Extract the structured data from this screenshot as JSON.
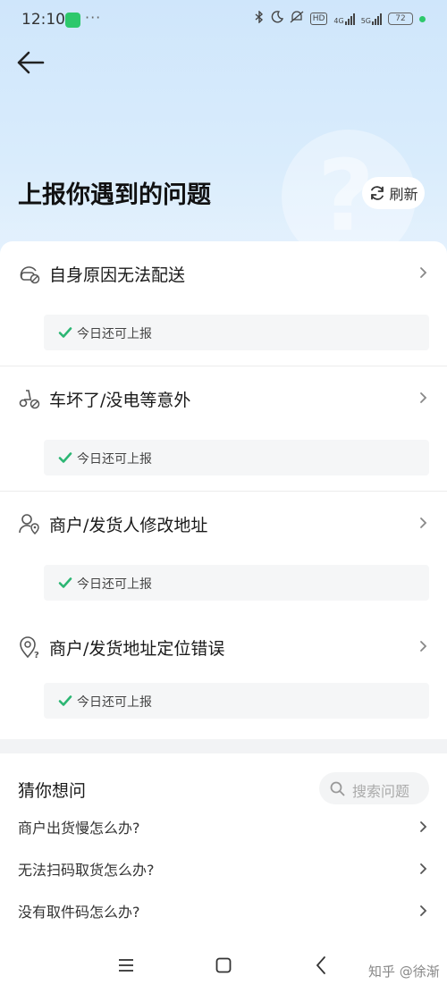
{
  "status_bar": {
    "time": "12:10",
    "dots": "···",
    "hd": "HD",
    "net4g": "4G",
    "net5g": "5G",
    "battery": "72"
  },
  "header": {
    "title": "上报你遇到的问题",
    "refresh_label": "刷新"
  },
  "issues": [
    {
      "title": "自身原因无法配送",
      "status": "今日还可上报",
      "icon": "scooter-rider-icon"
    },
    {
      "title": "车坏了/没电等意外",
      "status": "今日还可上报",
      "icon": "broken-scooter-icon"
    },
    {
      "title": "商户/发货人修改地址",
      "status": "今日还可上报",
      "icon": "user-location-icon"
    },
    {
      "title": "商户/发货地址定位错误",
      "status": "今日还可上报",
      "icon": "location-question-icon"
    }
  ],
  "faq": {
    "title": "猜你想问",
    "search_placeholder": "搜索问题",
    "items": [
      {
        "text": "商户出货慢怎么办?"
      },
      {
        "text": "无法扫码取货怎么办?"
      },
      {
        "text": "没有取件码怎么办?"
      }
    ]
  },
  "watermark": "知乎 @徐渐",
  "colors": {
    "header_bg": "#cfe6fb",
    "check_green": "#2bb673",
    "status_bg": "#f5f6f7"
  }
}
